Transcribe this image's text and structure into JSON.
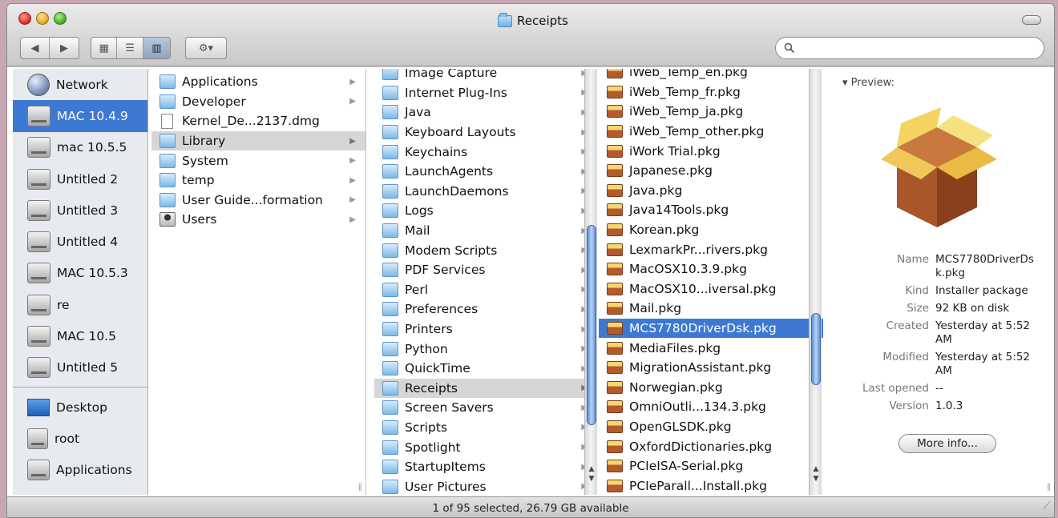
{
  "window": {
    "title": "Receipts"
  },
  "toolbar": {
    "back": "◀",
    "forward": "▶",
    "view_icons": "▦",
    "view_list": "☰",
    "view_columns": "▥",
    "action": "⚙▾",
    "search_placeholder": ""
  },
  "sidebar": {
    "devices": [
      {
        "label": "Network",
        "icon": "network-icon"
      },
      {
        "label": "MAC 10.4.9",
        "icon": "hard-drive-icon",
        "selected": true
      },
      {
        "label": "mac 10.5.5",
        "icon": "hard-drive-icon"
      },
      {
        "label": "Untitled 2",
        "icon": "hard-drive-icon"
      },
      {
        "label": "Untitled 3",
        "icon": "hard-drive-icon"
      },
      {
        "label": "Untitled 4",
        "icon": "hard-drive-icon"
      },
      {
        "label": "MAC 10.5.3",
        "icon": "hard-drive-icon"
      },
      {
        "label": "re",
        "icon": "hard-drive-icon"
      },
      {
        "label": "MAC 10.5",
        "icon": "hard-drive-icon"
      },
      {
        "label": "Untitled 5",
        "icon": "hard-drive-icon"
      }
    ],
    "places": [
      {
        "label": "Desktop",
        "icon": "desktop-icon"
      },
      {
        "label": "root",
        "icon": "home-icon"
      },
      {
        "label": "Applications",
        "icon": "applications-icon"
      }
    ]
  },
  "column1": {
    "items": [
      {
        "label": "Applications",
        "icon": "applications-folder-icon",
        "folder": true
      },
      {
        "label": "Developer",
        "icon": "developer-folder-icon",
        "folder": true
      },
      {
        "label": "Kernel_De...2137.dmg",
        "icon": "disk-image-icon",
        "folder": false
      },
      {
        "label": "Library",
        "icon": "library-folder-icon",
        "folder": true,
        "highlighted": true
      },
      {
        "label": "System",
        "icon": "folder-icon",
        "folder": true
      },
      {
        "label": "temp",
        "icon": "folder-icon",
        "folder": true
      },
      {
        "label": "User Guide...formation",
        "icon": "document-icon",
        "folder": true
      },
      {
        "label": "Users",
        "icon": "users-folder-icon",
        "folder": true
      }
    ]
  },
  "column2": {
    "items": [
      {
        "label": "Image Capture"
      },
      {
        "label": "Internet Plug-Ins"
      },
      {
        "label": "Java"
      },
      {
        "label": "Keyboard Layouts"
      },
      {
        "label": "Keychains"
      },
      {
        "label": "LaunchAgents"
      },
      {
        "label": "LaunchDaemons"
      },
      {
        "label": "Logs"
      },
      {
        "label": "Mail"
      },
      {
        "label": "Modem Scripts"
      },
      {
        "label": "PDF Services"
      },
      {
        "label": "Perl"
      },
      {
        "label": "Preferences"
      },
      {
        "label": "Printers"
      },
      {
        "label": "Python"
      },
      {
        "label": "QuickTime"
      },
      {
        "label": "Receipts",
        "highlighted": true
      },
      {
        "label": "Screen Savers"
      },
      {
        "label": "Scripts"
      },
      {
        "label": "Spotlight"
      },
      {
        "label": "StartupItems"
      },
      {
        "label": "User Pictures"
      }
    ]
  },
  "column3": {
    "items": [
      {
        "label": "iWeb_Temp_en.pkg"
      },
      {
        "label": "iWeb_Temp_fr.pkg"
      },
      {
        "label": "iWeb_Temp_ja.pkg"
      },
      {
        "label": "iWeb_Temp_other.pkg"
      },
      {
        "label": "iWork Trial.pkg"
      },
      {
        "label": "Japanese.pkg"
      },
      {
        "label": "Java.pkg"
      },
      {
        "label": "Java14Tools.pkg"
      },
      {
        "label": "Korean.pkg"
      },
      {
        "label": "LexmarkPr...rivers.pkg"
      },
      {
        "label": "MacOSX10.3.9.pkg"
      },
      {
        "label": "MacOSX10...iversal.pkg"
      },
      {
        "label": "Mail.pkg"
      },
      {
        "label": "MCS7780DriverDsk.pkg",
        "selected": true
      },
      {
        "label": "MediaFiles.pkg"
      },
      {
        "label": "MigrationAssistant.pkg"
      },
      {
        "label": "Norwegian.pkg"
      },
      {
        "label": "OmniOutli...134.3.pkg"
      },
      {
        "label": "OpenGLSDK.pkg"
      },
      {
        "label": "OxfordDictionaries.pkg"
      },
      {
        "label": "PCIeISA-Serial.pkg"
      },
      {
        "label": "PCIeParall...Install.pkg"
      }
    ]
  },
  "preview": {
    "header": "Preview:",
    "name_label": "Name",
    "name": "MCS7780DriverDsk.pkg",
    "kind_label": "Kind",
    "kind": "Installer package",
    "size_label": "Size",
    "size": "92 KB on disk",
    "created_label": "Created",
    "created": "Yesterday at 5:52 AM",
    "modified_label": "Modified",
    "modified": "Yesterday at 5:52 AM",
    "last_opened_label": "Last opened",
    "last_opened": "--",
    "version_label": "Version",
    "version": "1.0.3",
    "more_info": "More info..."
  },
  "status": {
    "text": "1 of 95 selected, 26.79 GB available"
  },
  "colors": {
    "selection": "#3d79d3",
    "highlight": "#d6d6d6"
  }
}
